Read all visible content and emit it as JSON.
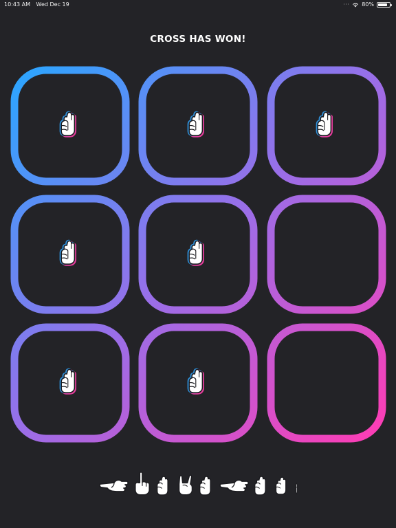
{
  "status_bar": {
    "time": "10:43 AM",
    "date": "Wed Dec 19",
    "battery": "80%",
    "battery_level": 0.8,
    "icons": [
      "wifi-icon",
      "battery-icon"
    ]
  },
  "game": {
    "status_text": "CROSS HAS WON!",
    "board": [
      [
        "hand-sign",
        "hand-sign",
        "hand-sign"
      ],
      [
        "hand-sign",
        "hand-sign",
        "empty"
      ],
      [
        "hand-sign",
        "hand-sign",
        "empty"
      ]
    ],
    "colors": {
      "gradient_start": "#2aa6ff",
      "gradient_mid": "#9a6ee8",
      "gradient_end": "#ff3cb4",
      "background": "#232327",
      "hand_outline_pink": "#e83e9e",
      "hand_outline_blue": "#2f8fd8"
    }
  },
  "sign_strip": {
    "icons": [
      "pointing-hand-icon",
      "index-up-hand-icon",
      "fist-hand-icon",
      "horns-hand-icon",
      "fist-hand-icon",
      "pointing-hand-icon",
      "fist-hand-icon",
      "thumb-hand-icon",
      "fist-hand-icon"
    ]
  }
}
